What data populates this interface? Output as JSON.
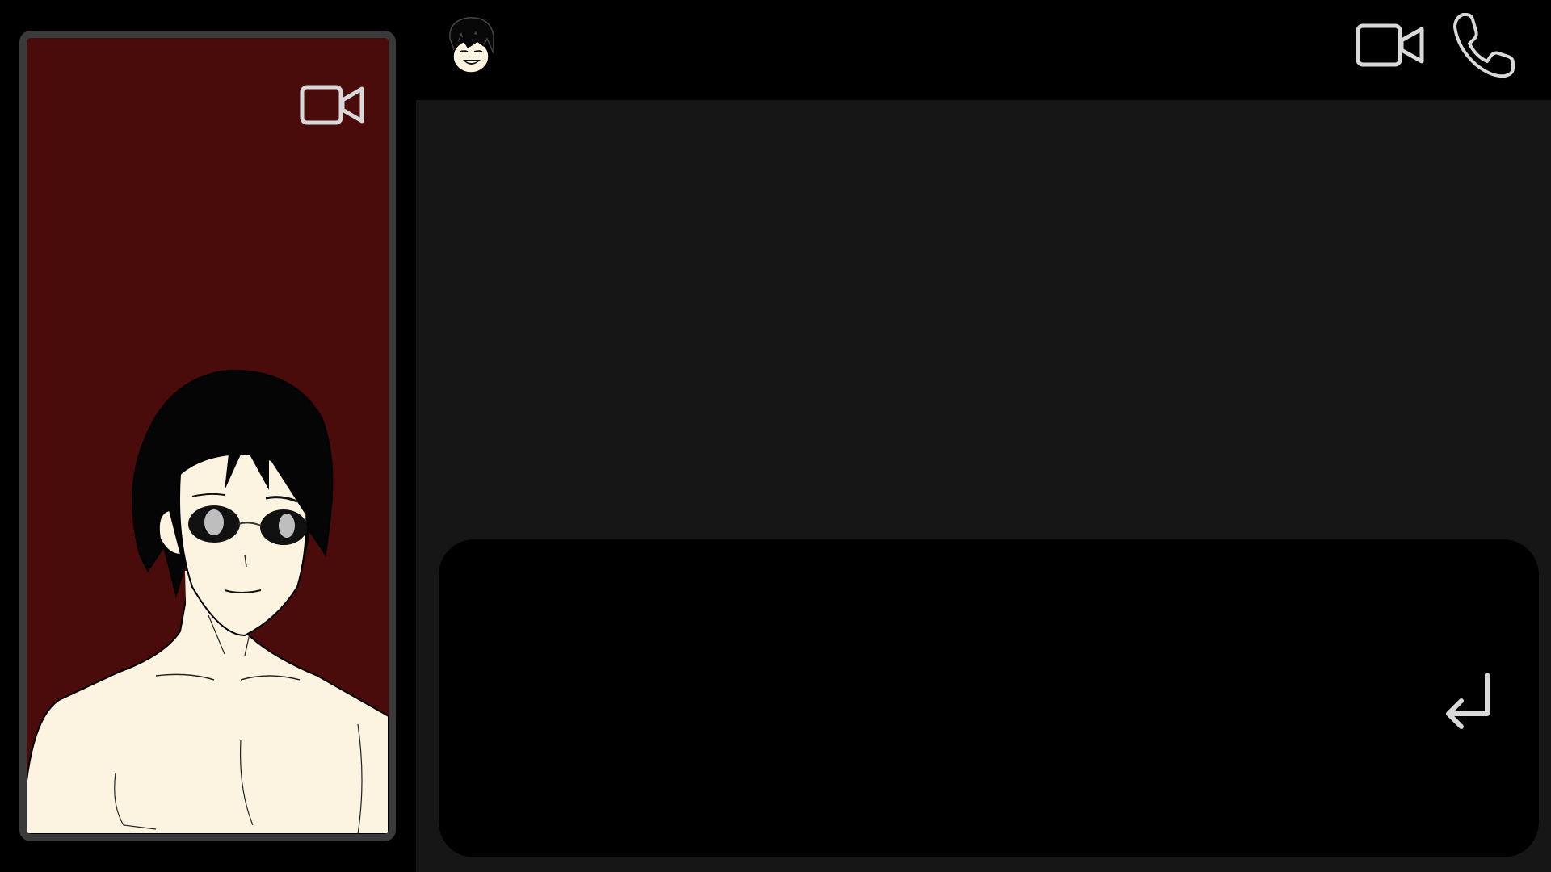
{
  "video_panel": {
    "camera_icon": "video-camera-icon",
    "background_color": "#4a0b0b",
    "frame_color": "#3a3a3a"
  },
  "header": {
    "avatar": "contact-avatar",
    "video_call_icon": "video-camera-icon",
    "voice_call_icon": "phone-icon"
  },
  "messages": {
    "background_color": "#161616"
  },
  "composer": {
    "input_value": "",
    "placeholder": "",
    "send_icon": "enter-return-icon"
  },
  "colors": {
    "icon_stroke": "#d9d9d9",
    "page_background": "#000000"
  }
}
